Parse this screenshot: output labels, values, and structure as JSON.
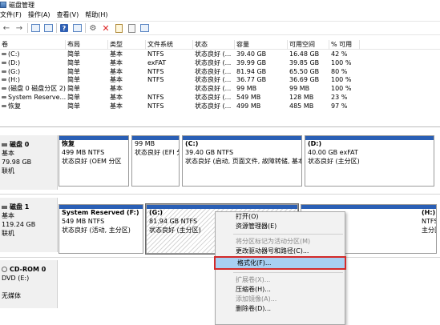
{
  "window": {
    "title": "磁盘管理"
  },
  "menu": [
    "文件(F)",
    "操作(A)",
    "查看(V)",
    "帮助(H)"
  ],
  "volume_table": {
    "headers": [
      "卷",
      "布局",
      "类型",
      "文件系统",
      "状态",
      "容量",
      "可用空间",
      "% 可用"
    ],
    "rows": [
      {
        "vol": "(C:)",
        "layout": "简单",
        "type": "基本",
        "fs": "NTFS",
        "status": "状态良好 (...",
        "capacity": "39.40 GB",
        "free": "16.48 GB",
        "pct": "42 %"
      },
      {
        "vol": "(D:)",
        "layout": "简单",
        "type": "基本",
        "fs": "exFAT",
        "status": "状态良好 (...",
        "capacity": "39.99 GB",
        "free": "39.85 GB",
        "pct": "100 %"
      },
      {
        "vol": "(G:)",
        "layout": "简单",
        "type": "基本",
        "fs": "NTFS",
        "status": "状态良好 (...",
        "capacity": "81.94 GB",
        "free": "65.50 GB",
        "pct": "80 %"
      },
      {
        "vol": "(H:)",
        "layout": "简单",
        "type": "基本",
        "fs": "NTFS",
        "status": "状态良好 (...",
        "capacity": "36.77 GB",
        "free": "36.69 GB",
        "pct": "100 %"
      },
      {
        "vol": "(磁盘 0 磁盘分区 2)",
        "layout": "简单",
        "type": "基本",
        "fs": "",
        "status": "状态良好 (...",
        "capacity": "99 MB",
        "free": "99 MB",
        "pct": "100 %"
      },
      {
        "vol": "System Reserve...",
        "layout": "简单",
        "type": "基本",
        "fs": "NTFS",
        "status": "状态良好 (...",
        "capacity": "549 MB",
        "free": "128 MB",
        "pct": "23 %"
      },
      {
        "vol": "恢复",
        "layout": "简单",
        "type": "基本",
        "fs": "NTFS",
        "status": "状态良好 (...",
        "capacity": "499 MB",
        "free": "485 MB",
        "pct": "97 %"
      }
    ]
  },
  "disks": [
    {
      "name": "磁盘 0",
      "type": "基本",
      "size": "79.98 GB",
      "status": "联机",
      "partitions": [
        {
          "name": "恢复",
          "size": "499 MB NTFS",
          "status": "状态良好 (OEM 分区"
        },
        {
          "name": "",
          "size": "99 MB",
          "status": "状态良好 (EFI 分"
        },
        {
          "name": "(C:)",
          "size": "39.40 GB NTFS",
          "status": "状态良好 (启动, 页面文件, 故障转储, 基本"
        },
        {
          "name": "(D:)",
          "size": "40.00 GB exFAT",
          "status": "状态良好 (主分区)"
        }
      ]
    },
    {
      "name": "磁盘 1",
      "type": "基本",
      "size": "119.24 GB",
      "status": "联机",
      "partitions": [
        {
          "name": "System Reserved  (F:)",
          "size": "549 MB NTFS",
          "status": "状态良好 (活动, 主分区)"
        },
        {
          "name": "(G:)",
          "size": "81.94 GB NTFS",
          "status": "状态良好 (主分区)"
        },
        {
          "name": "(H:)",
          "size": "NTFS",
          "status": "主分区)"
        }
      ]
    },
    {
      "name": "CD-ROM 0",
      "type": "DVD (E:)",
      "size": "",
      "status": "无媒体"
    }
  ],
  "context_menu": {
    "items": [
      {
        "label": "打开(O)",
        "disabled": false
      },
      {
        "label": "资源管理器(E)",
        "disabled": false
      },
      {
        "sep": true
      },
      {
        "label": "将分区标记为活动分区(M)",
        "disabled": true
      },
      {
        "label": "更改驱动器号和路径(C)...",
        "disabled": false
      },
      {
        "label": "格式化(F)...",
        "disabled": false,
        "highlight": true
      },
      {
        "sep": true
      },
      {
        "label": "扩展卷(X)...",
        "disabled": true
      },
      {
        "label": "压缩卷(H)...",
        "disabled": false
      },
      {
        "label": "添加镜像(A)...",
        "disabled": true
      },
      {
        "label": "删除卷(D)...",
        "disabled": false
      }
    ]
  }
}
